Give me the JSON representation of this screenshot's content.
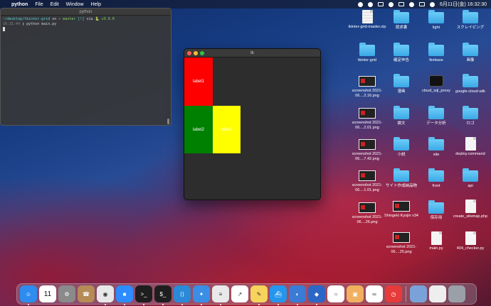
{
  "menubar": {
    "apple_glyph": "",
    "app_name": "python",
    "menus": [
      "File",
      "Edit",
      "Window",
      "Help"
    ],
    "datetime": "6月11日(金)  16:32:30"
  },
  "terminal": {
    "title": "python",
    "line1_path": "~/desktop/tkinter-grid",
    "line1_on": "on",
    "line1_branch": "master",
    "line1_status": "[!]",
    "line1_via": "via",
    "line1_version": "v3.9.0",
    "line2_time": "16:31:44",
    "line2_cmd": "python main.py"
  },
  "tk_window": {
    "title": "tk",
    "labels": [
      {
        "text": "label1",
        "bg": "#ff0000"
      },
      {
        "text": "label2",
        "bg": "#008000"
      },
      {
        "text": "label3",
        "bg": "#ffff00"
      }
    ]
  },
  "desktop": {
    "col1": [
      {
        "label": "tkinter-grid-master.zip",
        "kind": "zip"
      },
      {
        "label": "tkinter-grid",
        "kind": "folder"
      },
      {
        "label": "screenshot 2021-06....2.16.png",
        "kind": "shot"
      },
      {
        "label": "screenshot 2021-06....2.01.png",
        "kind": "shot"
      },
      {
        "label": "screenshot 2021-06....7.42.png",
        "kind": "shot"
      },
      {
        "label": "screenshot 2021-06....1.01.png",
        "kind": "shot"
      },
      {
        "label": "screenshot 2021-06....26.png",
        "kind": "shot"
      }
    ],
    "col2": [
      {
        "label": "請求書",
        "kind": "folder"
      },
      {
        "label": "確定申告",
        "kind": "folder"
      },
      {
        "label": "漫画",
        "kind": "folder"
      },
      {
        "label": "論文",
        "kind": "folder"
      },
      {
        "label": "小説",
        "kind": "folder"
      },
      {
        "label": "サイト作成納品物",
        "kind": "folder"
      },
      {
        "label": "Shingeki Kyojin v34",
        "kind": "shot"
      },
      {
        "label": "screenshot 2021-06....25.png",
        "kind": "shot"
      }
    ],
    "col3": [
      {
        "label": "light",
        "kind": "folder"
      },
      {
        "label": "firebase",
        "kind": "folder"
      },
      {
        "label": "cloud_sql_proxy",
        "kind": "term"
      },
      {
        "label": "データ分析",
        "kind": "folder"
      },
      {
        "label": "site",
        "kind": "folder"
      },
      {
        "label": "front",
        "kind": "folder"
      },
      {
        "label": "保存用",
        "kind": "folder"
      },
      {
        "label": "main.py",
        "kind": "doc"
      }
    ],
    "col4": [
      {
        "label": "スクレイピング",
        "kind": "folder"
      },
      {
        "label": "画像",
        "kind": "folder"
      },
      {
        "label": "google-cloud-sdk",
        "kind": "folder"
      },
      {
        "label": "ロゴ",
        "kind": "folder"
      },
      {
        "label": "deploy.command",
        "kind": "doc"
      },
      {
        "label": "api",
        "kind": "folder"
      },
      {
        "label": "create_sitemap.php",
        "kind": "doc"
      },
      {
        "label": "404_checker.py",
        "kind": "doc"
      }
    ]
  },
  "dock": {
    "calendar_day": "11",
    "apps": [
      "Finder",
      "Calendar",
      "System Preferences",
      "Contacts",
      "Chrome",
      "Zoom",
      "Terminal",
      "iTerm",
      "VS Code",
      "Safari",
      "Python",
      "Activity",
      "Notes",
      "Docker",
      "Monitor",
      "Sourcetree",
      "Camo",
      "Preview",
      "Infinity",
      "Clock"
    ],
    "colors": {
      "Finder": "#2d8cf0",
      "Calendar": "#ffffff",
      "System Preferences": "#8a8a8a",
      "Contacts": "#b58b56",
      "Chrome": "#e8e8e8",
      "Zoom": "#2d8cff",
      "Terminal": "#1e1e1e",
      "iTerm": "#1e1e1e",
      "VS Code": "#2b8ad8",
      "Safari": "#3a8ee6",
      "Python": "#e9e9e9",
      "Activity": "#ffffff",
      "Notes": "#f6d35a",
      "Docker": "#2496ed",
      "Monitor": "#3a7bd5",
      "Sourcetree": "#2b67c6",
      "Camo": "#ffffff",
      "Preview": "#f0b060",
      "Infinity": "#ffffff",
      "Clock": "#e73b3b"
    }
  }
}
